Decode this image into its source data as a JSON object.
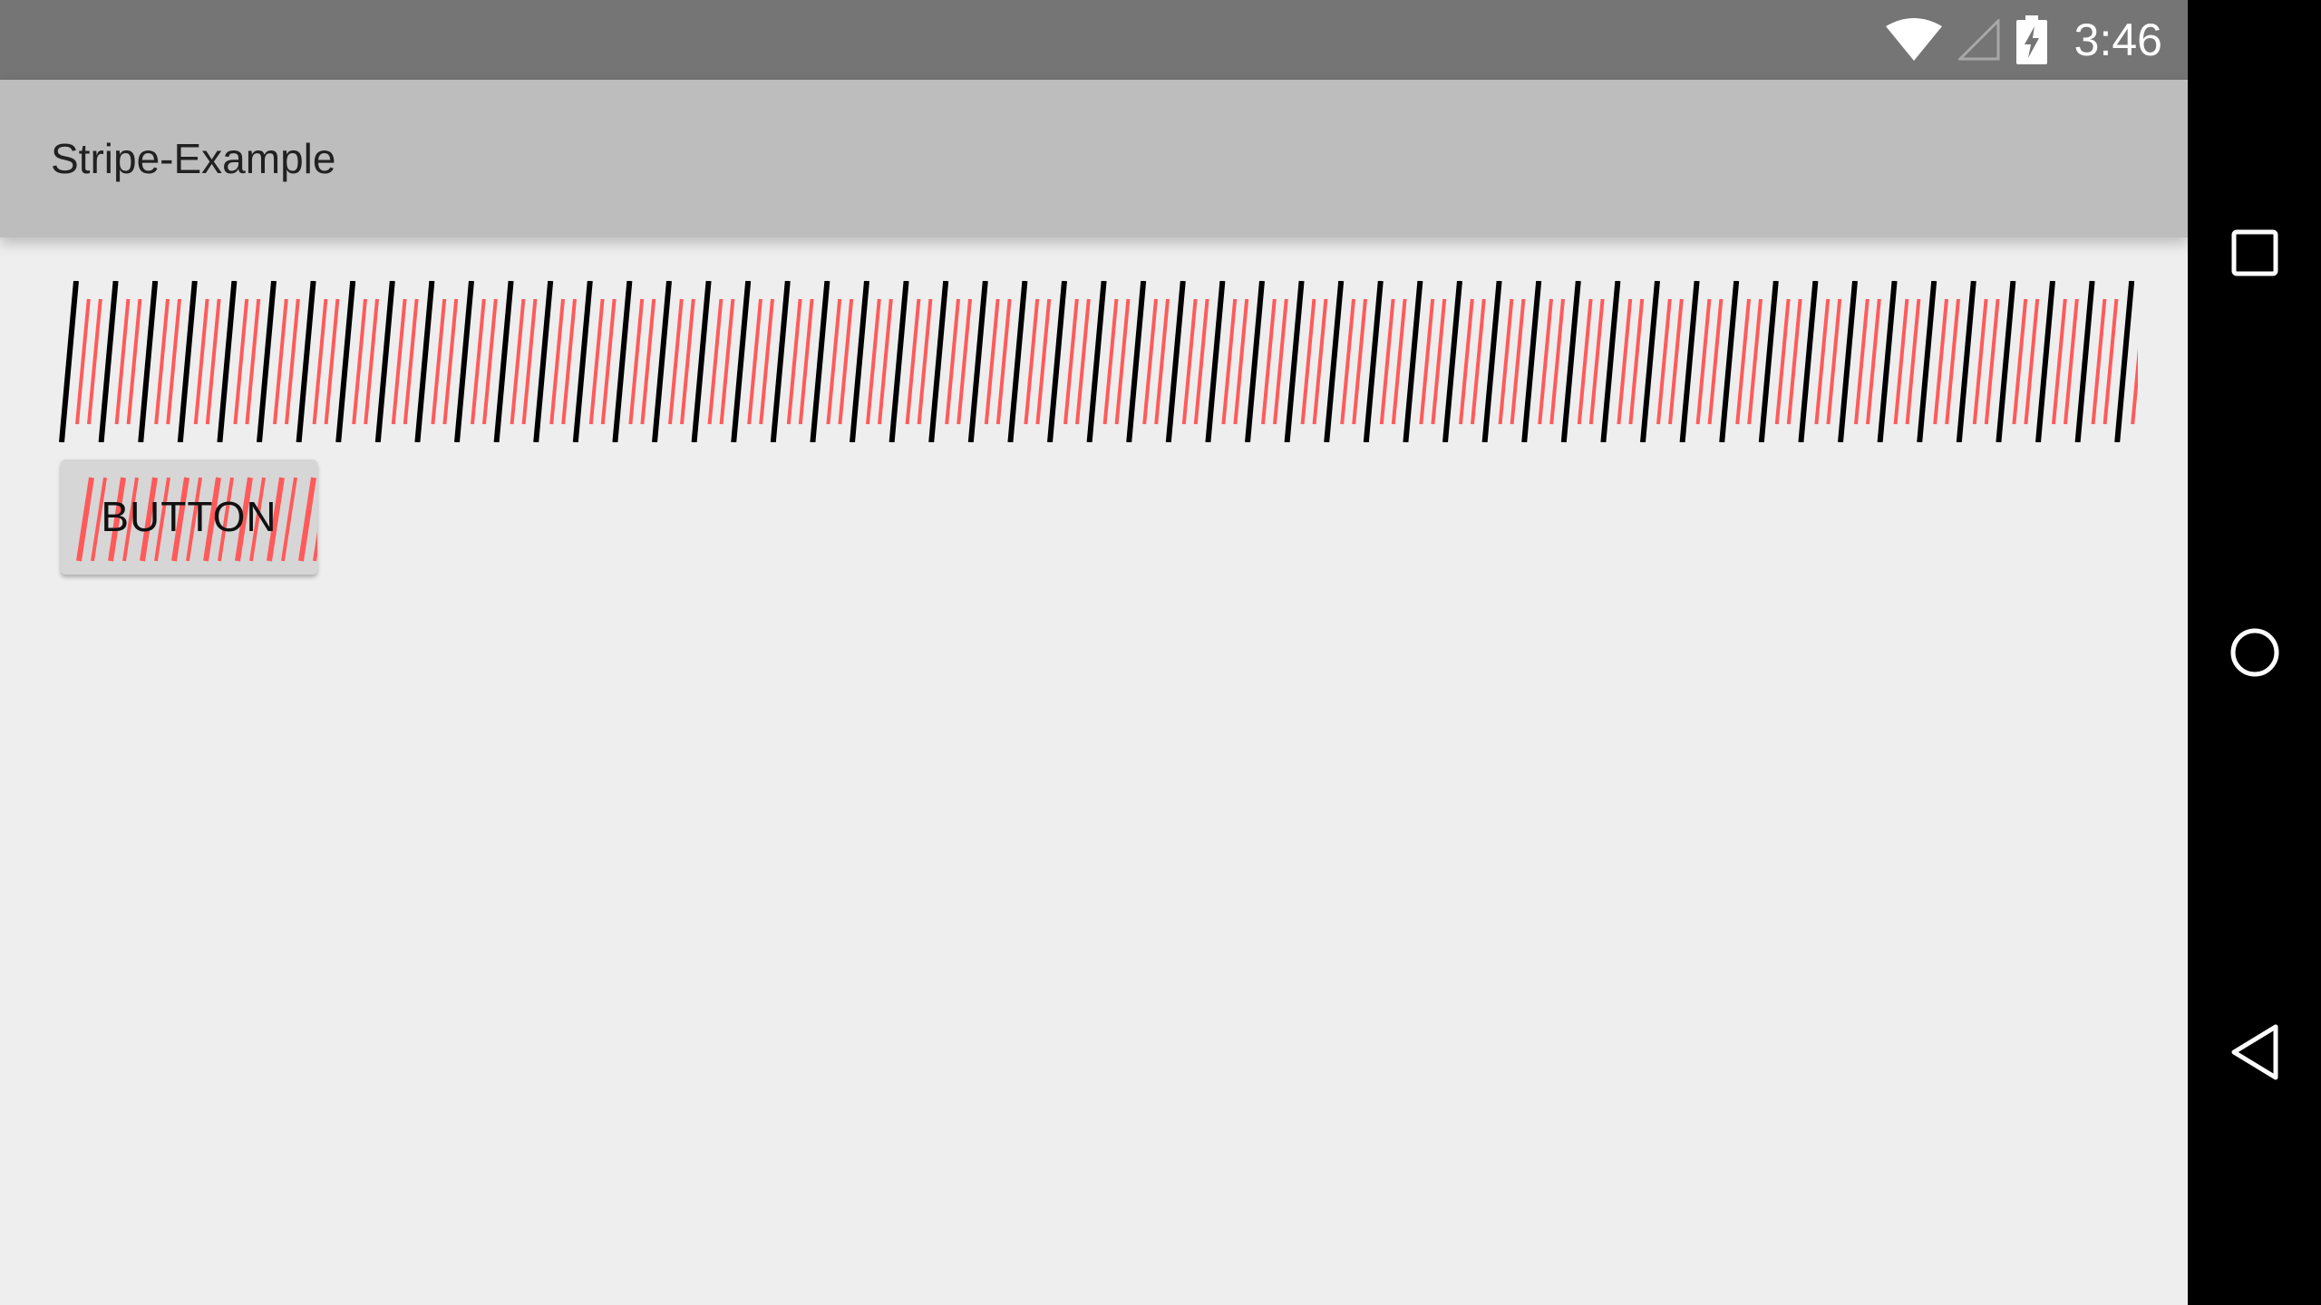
{
  "status_bar": {
    "time": "3:46",
    "icons": [
      "wifi-icon",
      "cell-signal-icon",
      "battery-charging-icon"
    ]
  },
  "app_bar": {
    "title": "Stripe-Example"
  },
  "stripe_view": {
    "colors": {
      "thick_stripe": "#000000",
      "thin_stripe": "#ff5a5a",
      "background": "#eeeeee"
    }
  },
  "button": {
    "label": "BUTTON",
    "colors": {
      "background": "#d6d6d6",
      "stripe": "#ff5a5a"
    }
  },
  "nav_bar": {
    "buttons": [
      "recents-icon",
      "home-icon",
      "back-icon"
    ]
  },
  "colors": {
    "status_bar": "#757575",
    "app_bar": "#bdbdbd",
    "content_bg": "#eeeeee",
    "nav_bar": "#000000"
  }
}
